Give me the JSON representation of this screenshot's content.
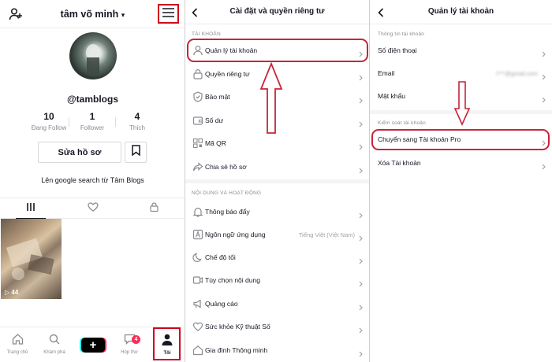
{
  "profile": {
    "username": "tâm võ minh",
    "username_caret": "▾",
    "handle": "@tamblogs",
    "stats": [
      {
        "value": "10",
        "label": "Đang Follow"
      },
      {
        "value": "1",
        "label": "Follower"
      },
      {
        "value": "4",
        "label": "Thích"
      }
    ],
    "edit_button": "Sửa hồ sơ",
    "bio": "Lên google search từ Tâm Blogs",
    "video_views": "44",
    "nav": [
      {
        "label": "Trang chủ",
        "icon": "home-icon"
      },
      {
        "label": "Khám phá",
        "icon": "search-icon"
      },
      {
        "label": "",
        "icon": "plus-icon"
      },
      {
        "label": "Hộp thư",
        "icon": "inbox-icon"
      },
      {
        "label": "Tôi",
        "icon": "profile-icon"
      }
    ],
    "inbox_badge": "4",
    "plus_symbol": "+"
  },
  "settings": {
    "title": "Cài đặt và quyền riêng tư",
    "section_account": "TÀI KHOẢN",
    "account_items": [
      {
        "label": "Quản lý tài khoản",
        "icon": "user-icon"
      },
      {
        "label": "Quyền riêng tư",
        "icon": "lock-icon"
      },
      {
        "label": "Bảo mật",
        "icon": "shield-icon"
      },
      {
        "label": "Số dư",
        "icon": "wallet-icon"
      },
      {
        "label": "Mã QR",
        "icon": "qr-icon"
      },
      {
        "label": "Chia sẻ hồ sơ",
        "icon": "share-icon"
      }
    ],
    "section_content": "NỘI DUNG VÀ HOẠT ĐỘNG",
    "content_items": [
      {
        "label": "Thông báo đẩy",
        "icon": "bell-icon",
        "value": ""
      },
      {
        "label": "Ngôn ngữ ứng dụng",
        "icon": "language-icon",
        "value": "Tiếng Việt (Việt Nam)"
      },
      {
        "label": "Chế độ tối",
        "icon": "moon-icon",
        "value": ""
      },
      {
        "label": "Tùy chọn nội dung",
        "icon": "video-icon",
        "value": ""
      },
      {
        "label": "Quảng cáo",
        "icon": "megaphone-icon",
        "value": ""
      },
      {
        "label": "Sức khỏe Kỹ thuật Số",
        "icon": "heart-icon",
        "value": ""
      },
      {
        "label": "Gia đình Thông minh",
        "icon": "home-icon",
        "value": ""
      }
    ]
  },
  "account": {
    "title": "Quản lý tài khoản",
    "section_info": "Thông tin tài khoản",
    "info_items": [
      {
        "label": "Số điện thoại",
        "value": ""
      },
      {
        "label": "Email",
        "value": "t***@gmail.com"
      },
      {
        "label": "Mật khẩu",
        "value": ""
      }
    ],
    "section_control": "Kiểm soát tài khoản",
    "control_items": [
      {
        "label": "Chuyển sang Tài khoản Pro"
      },
      {
        "label": "Xóa Tài khoản"
      }
    ]
  },
  "colors": {
    "highlight": "#c6253a",
    "accent": "#fe2c55",
    "text": "#161823",
    "muted": "#8a8b91"
  }
}
